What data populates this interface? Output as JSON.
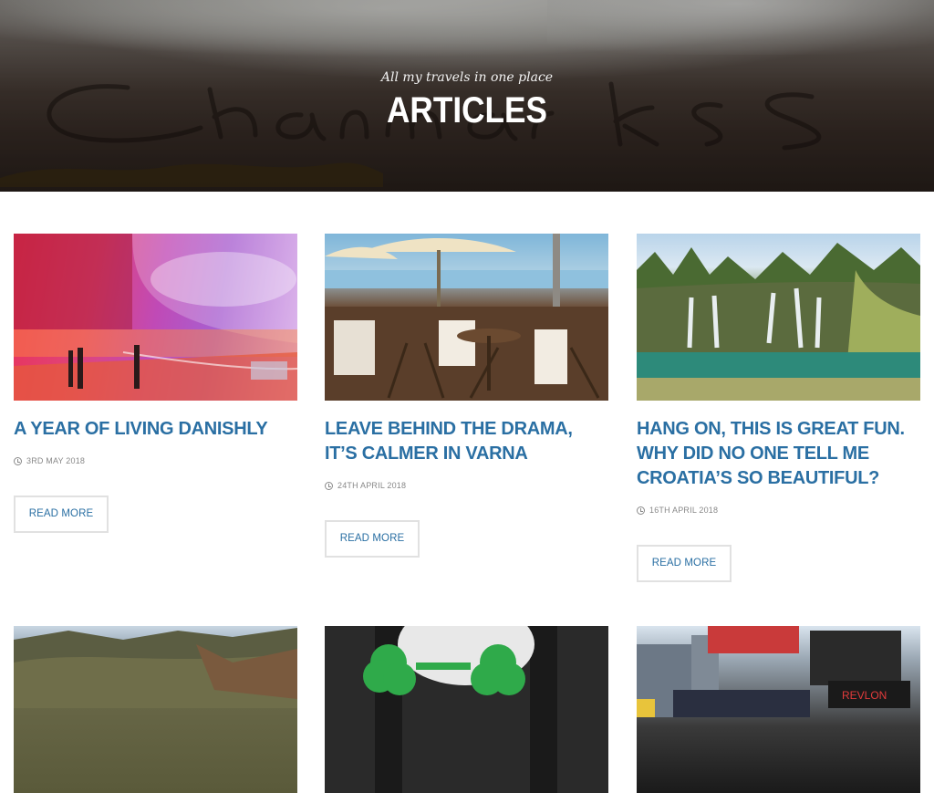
{
  "hero": {
    "subtitle": "All my travels in one place",
    "title": "ARTICLES"
  },
  "articles": [
    {
      "title": "A YEAR OF LIVING DANISHLY",
      "date": "3RD MAY 2018",
      "button": "READ MORE",
      "image": "rainbow-panorama-image"
    },
    {
      "title": "LEAVE BEHIND THE DRAMA, IT’S CALMER IN VARNA",
      "date": "24TH APRIL 2018",
      "button": "READ MORE",
      "image": "beach-cafe-image"
    },
    {
      "title": "HANG ON, THIS IS GREAT FUN. WHY DID NO ONE TELL ME CROATIA’S SO BEAUTIFUL?",
      "date": "16TH APRIL 2018",
      "button": "READ MORE",
      "image": "waterfall-lake-image"
    },
    {
      "image": "mountain-valley-image"
    },
    {
      "image": "shamrock-glasses-image"
    },
    {
      "image": "times-square-image"
    }
  ],
  "colors": {
    "link": "#2a6fa3",
    "date": "#888888",
    "border": "#e1e1e1"
  }
}
